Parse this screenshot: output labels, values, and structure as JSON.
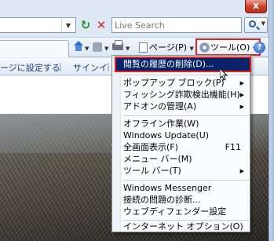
{
  "window": {
    "close_glyph": "x"
  },
  "address_bar": {
    "dropdown_glyph": "▼"
  },
  "toolbar": {
    "refresh_glyph": "↻",
    "stop_glyph": "✕",
    "search_placeholder": "Live Search",
    "search_dd_glyph": "▼"
  },
  "command_bar": {
    "page_label": "ページ(P)",
    "tools_label": "ツール(O)",
    "dropdown_glyph": "▼",
    "help_glyph": "?"
  },
  "links_bar": {
    "text1": "ージに設定する",
    "sep": "|",
    "text2": "サインイ"
  },
  "tools_menu": {
    "items": [
      {
        "label": "閲覧の履歴の削除(D)..."
      },
      {
        "label": "ポップアップ ブロック(P)"
      },
      {
        "label": "フィッシング詐欺検出機能(H)"
      },
      {
        "label": "アドオンの管理(A)"
      },
      {
        "label": "オフライン作業(W)"
      },
      {
        "label": "Windows Update(U)"
      },
      {
        "label": "全画面表示(F)",
        "shortcut": "F11"
      },
      {
        "label": "メニュー バー(M)"
      },
      {
        "label": "ツール バー(T)"
      },
      {
        "label": "Windows Messenger"
      },
      {
        "label": "接続の問題の診断..."
      },
      {
        "label": "ウェブディフェンダー設定"
      },
      {
        "label": "インターネット オプション(O)"
      }
    ],
    "submenu_glyph": "▶"
  }
}
